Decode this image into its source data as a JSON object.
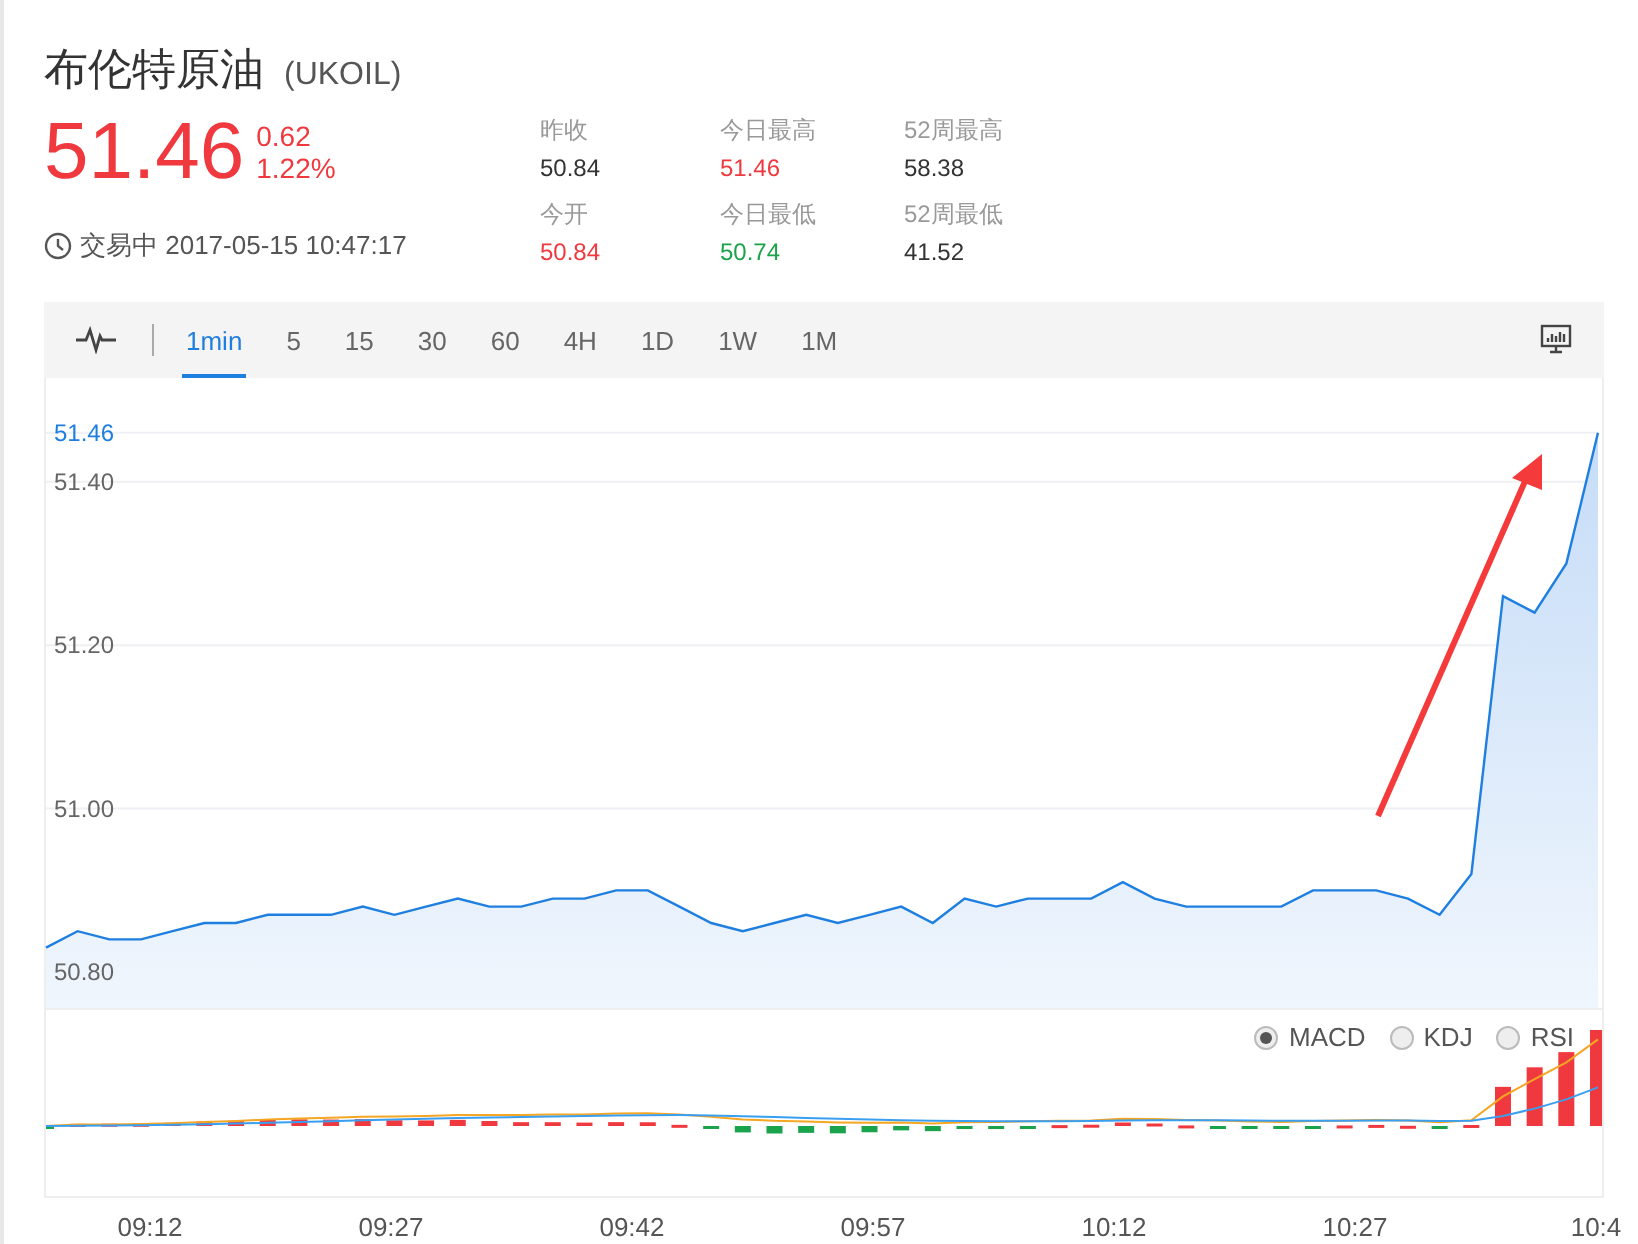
{
  "header": {
    "title": "布伦特原油",
    "symbol": "(UKOIL)",
    "price": "51.46",
    "change": "0.62",
    "change_percent": "1.22%",
    "status": "交易中 2017-05-15 10:47:17"
  },
  "stats": [
    {
      "label": "昨收",
      "value": "50.84",
      "color": "#333333"
    },
    {
      "label": "今日最高",
      "value": "51.46",
      "color": "#f0393e"
    },
    {
      "label": "52周最高",
      "value": "58.38",
      "color": "#333333"
    },
    {
      "label": "今开",
      "value": "50.84",
      "color": "#f0393e"
    },
    {
      "label": "今日最低",
      "value": "50.74",
      "color": "#1aa34a"
    },
    {
      "label": "52周最低",
      "value": "41.52",
      "color": "#333333"
    }
  ],
  "periods": [
    {
      "label": "1min",
      "selected": true
    },
    {
      "label": "5",
      "selected": false
    },
    {
      "label": "15",
      "selected": false
    },
    {
      "label": "30",
      "selected": false
    },
    {
      "label": "60",
      "selected": false
    },
    {
      "label": "4H",
      "selected": false
    },
    {
      "label": "1D",
      "selected": false
    },
    {
      "label": "1W",
      "selected": false
    },
    {
      "label": "1M",
      "selected": false
    }
  ],
  "price_chart": {
    "chart_data": {
      "type": "area",
      "grid": true,
      "ylim": [
        50.756,
        51.527
      ],
      "yticks": [
        {
          "value": 50.8,
          "label": "50.80"
        },
        {
          "value": 51.0,
          "label": "51.00"
        },
        {
          "value": 51.2,
          "label": "51.20"
        },
        {
          "value": 51.4,
          "label": "51.40"
        },
        {
          "value": 51.46,
          "label": "51.46"
        }
      ],
      "values": [
        50.83,
        50.85,
        50.84,
        50.84,
        50.85,
        50.86,
        50.86,
        50.87,
        50.87,
        50.87,
        50.88,
        50.87,
        50.88,
        50.89,
        50.88,
        50.88,
        50.89,
        50.89,
        50.9,
        50.9,
        50.88,
        50.86,
        50.85,
        50.86,
        50.87,
        50.86,
        50.87,
        50.88,
        50.86,
        50.89,
        50.88,
        50.89,
        50.89,
        50.89,
        50.91,
        50.89,
        50.88,
        50.88,
        50.88,
        50.88,
        50.9,
        50.9,
        50.9,
        50.89,
        50.87,
        50.92,
        51.26,
        51.24,
        51.3,
        51.46
      ]
    }
  },
  "indicators": [
    {
      "label": "MACD",
      "selected": true
    },
    {
      "label": "KDJ",
      "selected": false
    },
    {
      "label": "RSI",
      "selected": false
    }
  ],
  "time_axis": [
    "09:12",
    "09:27",
    "09:42",
    "09:57",
    "10:12",
    "10:27",
    "10:4"
  ]
}
